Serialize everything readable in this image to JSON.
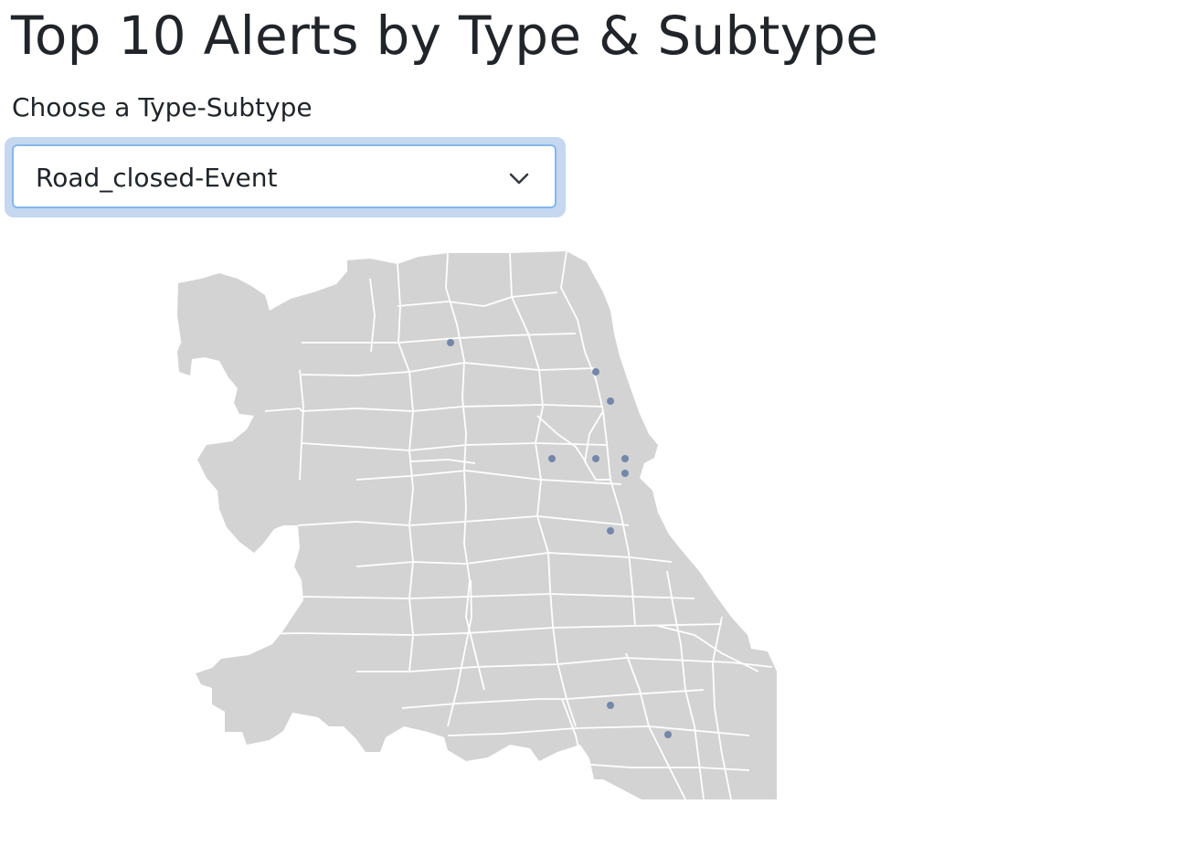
{
  "header": {
    "title": "Top 10 Alerts by Type & Subtype"
  },
  "filter": {
    "label": "Choose a Type-Subtype",
    "selected_value": "Road_closed-Event",
    "chevron_icon": "chevron-down-icon"
  },
  "map": {
    "region": "Chicago",
    "land_color": "#d3d3d3",
    "boundary_color": "#ffffff",
    "point_color": "#7587a8",
    "alert_count": 10
  }
}
